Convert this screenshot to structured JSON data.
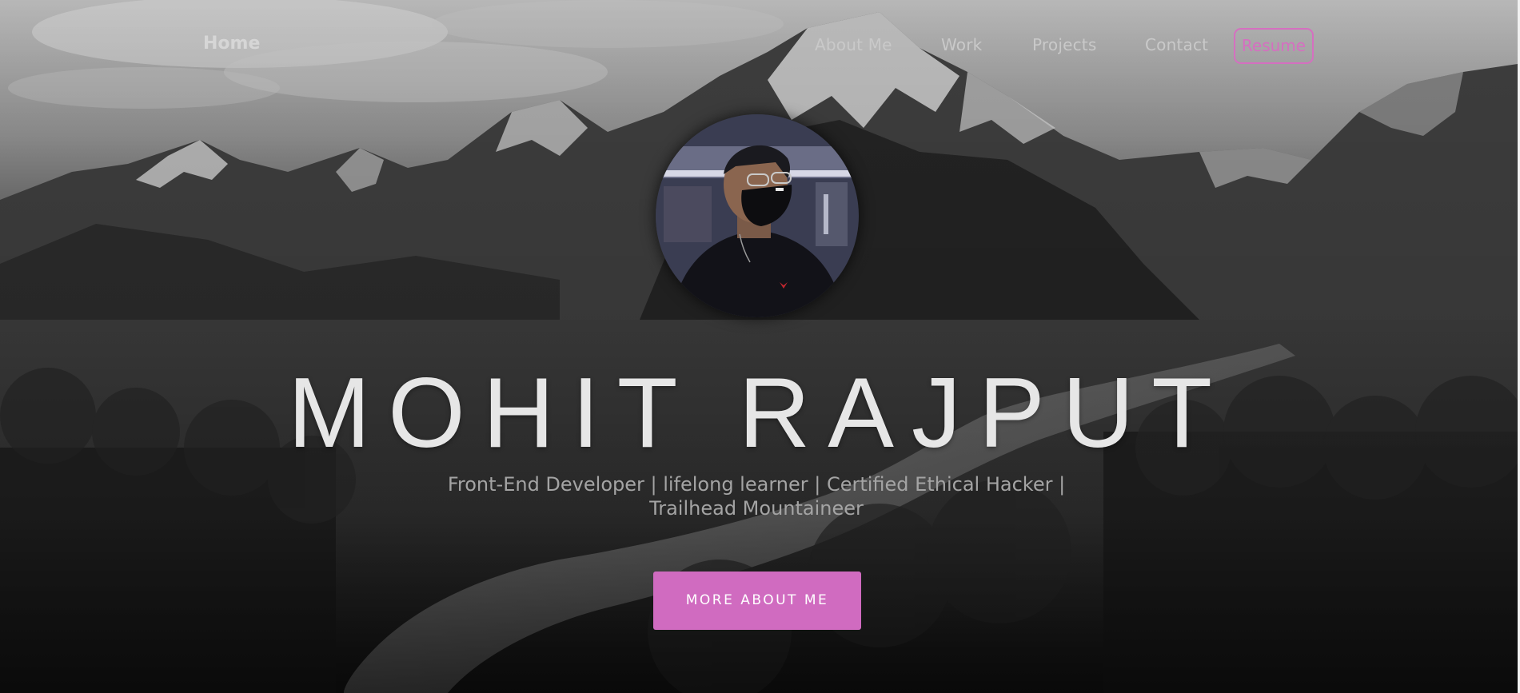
{
  "nav": {
    "home_label": "Home",
    "links": [
      {
        "label": "About Me"
      },
      {
        "label": "Work"
      },
      {
        "label": "Projects"
      },
      {
        "label": "Contact"
      }
    ],
    "resume_label": "Resume"
  },
  "hero": {
    "name": "MOHIT RAJPUT",
    "tagline_line1": "Front-End Developer | lifelong learner | Certified Ethical Hacker |",
    "tagline_line2": "Trailhead Mountaineer",
    "cta_label": "MORE ABOUT ME"
  },
  "colors": {
    "accent": "#d06bc0",
    "resume_border": "#d56fc0",
    "nav_text": "#c9c9c9",
    "name_text": "#e6e6e6",
    "tagline_text": "#a4a4a4"
  },
  "icons": {
    "avatar": "profile-photo"
  }
}
